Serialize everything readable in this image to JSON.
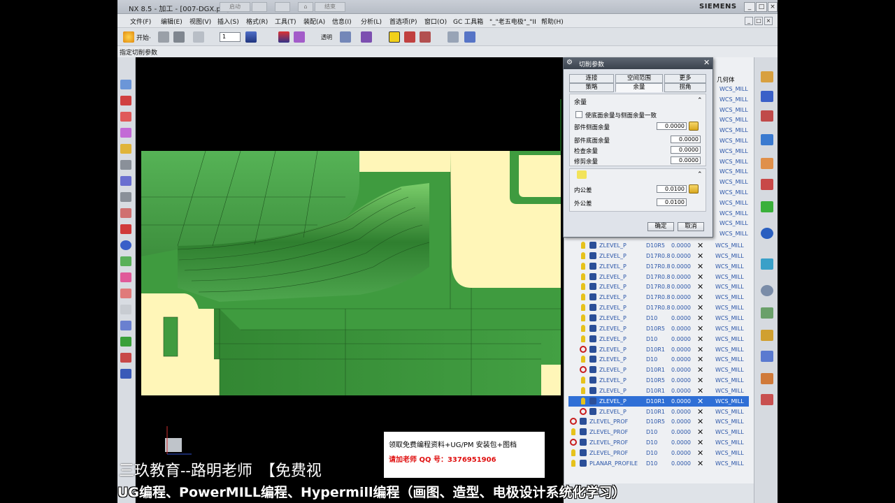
{
  "window": {
    "title": "NX 8.5 - 加工 - [007-DGX.prt]",
    "tabs": [
      "启动",
      "结束"
    ],
    "brand": "SIEMENS",
    "controls": [
      "_",
      "□",
      "×"
    ]
  },
  "menu": [
    "文件(F)",
    "编辑(E)",
    "视图(V)",
    "插入(S)",
    "格式(R)",
    "工具(T)",
    "装配(A)",
    "信息(I)",
    "分析(L)",
    "首选项(P)",
    "窗口(O)",
    "GC 工具箱",
    "\"_\"老五电极\"_\"II",
    "帮助(H)"
  ],
  "toolbar": {
    "start_label": "开始·",
    "combo_value": "1",
    "transparency_label": "透明"
  },
  "statusline": "指定切削参数",
  "dialog": {
    "title": "切削参数",
    "tabs_row1": [
      "连接",
      "空间范围",
      "更多"
    ],
    "tabs_row2": [
      "策略",
      "余量",
      "拐角"
    ],
    "active_tab": "余量",
    "section_stock": {
      "header": "余量",
      "checkbox_label": "使底面余量与侧面余量一致",
      "fields": [
        {
          "label": "部件侧面余量",
          "value": "0.0000"
        },
        {
          "label": "部件底面余量",
          "value": "0.0000"
        },
        {
          "label": "检查余量",
          "value": "0.0000"
        },
        {
          "label": "修剪余量",
          "value": "0.0000"
        }
      ]
    },
    "section_tolerance": {
      "fields": [
        {
          "label": "内公差",
          "value": "0.0100"
        },
        {
          "label": "外公差",
          "value": "0.0100"
        }
      ]
    },
    "ok_label": "确定",
    "cancel_label": "取消"
  },
  "navigator": {
    "column_header": "几何体",
    "top_geometry": [
      "WCS_MILL",
      "WCS_MILL",
      "WCS_MILL",
      "WCS_MILL",
      "WCS_MILL",
      "WCS_MILL",
      "WCS_MILL",
      "WCS_MILL",
      "WCS_MILL",
      "WCS_MILL",
      "WCS_MILL",
      "WCS_MILL",
      "WCS_MILL",
      "WCS_MILL",
      "WCS_MILL"
    ],
    "rows": [
      {
        "icon": "bulb",
        "name": "ZLEVEL_P",
        "tool": "D10R5",
        "stock": "0.0000",
        "geom": "WCS_MILL",
        "sel": false
      },
      {
        "icon": "bulb",
        "name": "ZLEVEL_P",
        "tool": "D17R0.8",
        "stock": "0.0000",
        "geom": "WCS_MILL",
        "sel": false
      },
      {
        "icon": "bulb",
        "name": "ZLEVEL_P",
        "tool": "D17R0.8",
        "stock": "0.0000",
        "geom": "WCS_MILL",
        "sel": false
      },
      {
        "icon": "bulb",
        "name": "ZLEVEL_P",
        "tool": "D17R0.8",
        "stock": "0.0000",
        "geom": "WCS_MILL",
        "sel": false
      },
      {
        "icon": "bulb",
        "name": "ZLEVEL_P",
        "tool": "D17R0.8",
        "stock": "0.0000",
        "geom": "WCS_MILL",
        "sel": false
      },
      {
        "icon": "bulb",
        "name": "ZLEVEL_P",
        "tool": "D17R0.8",
        "stock": "0.0000",
        "geom": "WCS_MILL",
        "sel": false
      },
      {
        "icon": "bulb",
        "name": "ZLEVEL_P",
        "tool": "D17R0.8",
        "stock": "0.0000",
        "geom": "WCS_MILL",
        "sel": false
      },
      {
        "icon": "bulb",
        "name": "ZLEVEL_P",
        "tool": "D10",
        "stock": "0.0000",
        "geom": "WCS_MILL",
        "sel": false
      },
      {
        "icon": "bulb",
        "name": "ZLEVEL_P",
        "tool": "D10R5",
        "stock": "0.0000",
        "geom": "WCS_MILL",
        "sel": false
      },
      {
        "icon": "bulb",
        "name": "ZLEVEL_P",
        "tool": "D10",
        "stock": "0.0000",
        "geom": "WCS_MILL",
        "sel": false
      },
      {
        "icon": "stop",
        "name": "ZLEVEL_P",
        "tool": "D10R1",
        "stock": "0.0000",
        "geom": "WCS_MILL",
        "sel": false
      },
      {
        "icon": "bulb",
        "name": "ZLEVEL_P",
        "tool": "D10",
        "stock": "0.0000",
        "geom": "WCS_MILL",
        "sel": false
      },
      {
        "icon": "stop",
        "name": "ZLEVEL_P",
        "tool": "D10R1",
        "stock": "0.0000",
        "geom": "WCS_MILL",
        "sel": false
      },
      {
        "icon": "bulb",
        "name": "ZLEVEL_P",
        "tool": "D10R5",
        "stock": "0.0000",
        "geom": "WCS_MILL",
        "sel": false
      },
      {
        "icon": "bulb",
        "name": "ZLEVEL_P",
        "tool": "D10R1",
        "stock": "0.0000",
        "geom": "WCS_MILL",
        "sel": false
      },
      {
        "icon": "bulb",
        "name": "ZLEVEL_P",
        "tool": "D10R1",
        "stock": "0.0000",
        "geom": "WCS_MILL",
        "sel": true
      },
      {
        "icon": "stop",
        "name": "ZLEVEL_P",
        "tool": "D10R1",
        "stock": "0.0000",
        "geom": "WCS_MILL",
        "sel": false
      },
      {
        "icon": "stop",
        "name": "ZLEVEL_PROF",
        "tool": "D10R5",
        "stock": "0.0000",
        "geom": "WCS_MILL",
        "sel": false
      },
      {
        "icon": "bulb",
        "name": "ZLEVEL_PROF",
        "tool": "D10",
        "stock": "0.0000",
        "geom": "WCS_MILL",
        "sel": false
      },
      {
        "icon": "stop",
        "name": "ZLEVEL_PROF",
        "tool": "D10",
        "stock": "0.0000",
        "geom": "WCS_MILL",
        "sel": false
      },
      {
        "icon": "bulb",
        "name": "ZLEVEL_PROF",
        "tool": "D10",
        "stock": "0.0000",
        "geom": "WCS_MILL",
        "sel": false
      },
      {
        "icon": "bulb",
        "name": "PLANAR_PROFILE",
        "tool": "D10",
        "stock": "0.0000",
        "geom": "WCS_MILL",
        "sel": false
      }
    ]
  },
  "overlay": {
    "line1": "三玖教育--路明老师　【免费视",
    "line2": "UG编程、PowerMILL编程、Hypermill编程（画图、造型、电极设计系统化学习）",
    "ad_line1": "领取免费编程资料+UG/PM 安装包+图档",
    "ad_line2": "请加老师 QQ 号：3376951906"
  },
  "colors": {
    "model_green": "#3f9b3f",
    "model_cream": "#fff6b8",
    "selection": "#2f6fd6"
  }
}
